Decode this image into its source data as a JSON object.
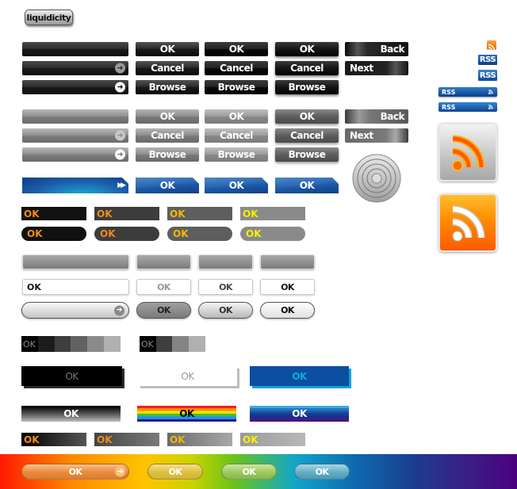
{
  "brand": {
    "label": "liquidicity"
  },
  "dark_section": {
    "col1": {
      "ok": "OK",
      "cancel": "Cancel",
      "browse": "Browse"
    },
    "col2": {
      "ok": "OK",
      "cancel": "Cancel",
      "browse": "Browse"
    },
    "col3": {
      "ok": "OK",
      "cancel": "Cancel",
      "browse": "Browse"
    },
    "back": "Back",
    "next": "Next",
    "arrow_icon": "➜"
  },
  "grey_section": {
    "col1": {
      "ok": "OK",
      "cancel": "Cancel",
      "browse": "Browse"
    },
    "col2": {
      "ok": "OK",
      "cancel": "Cancel",
      "browse": "Browse"
    },
    "col3": {
      "ok": "OK",
      "cancel": "Cancel",
      "browse": "Browse"
    },
    "back": "Back",
    "next": "Next",
    "arrow_icon": "➜"
  },
  "blue_section": {
    "forward_icon": "▶▶",
    "buttons": [
      "OK",
      "OK",
      "OK"
    ]
  },
  "rss": {
    "label": "RSS",
    "feed_icon": "rss"
  },
  "orange_labels": {
    "square": [
      "OK",
      "OK",
      "OK",
      "OK"
    ],
    "rounded": [
      "OK",
      "OK",
      "OK",
      "OK"
    ],
    "gradient": [
      "OK",
      "OK",
      "OK",
      "OK"
    ],
    "colors": {
      "orange": "#f08c1a",
      "amber": "#f5b800",
      "yellow": "#f5f000"
    }
  },
  "white_section": {
    "boxes": [
      "OK",
      "OK",
      "OK",
      "OK"
    ],
    "pills": [
      "OK",
      "OK",
      "OK"
    ]
  },
  "swatches": {
    "set1_label": "OK",
    "set2_label": "OK"
  },
  "three_d": [
    "OK",
    "OK",
    "OK"
  ],
  "striped": [
    "OK",
    "OK",
    "OK"
  ],
  "rainbow_pills": [
    "OK",
    "OK",
    "OK",
    "OK"
  ]
}
